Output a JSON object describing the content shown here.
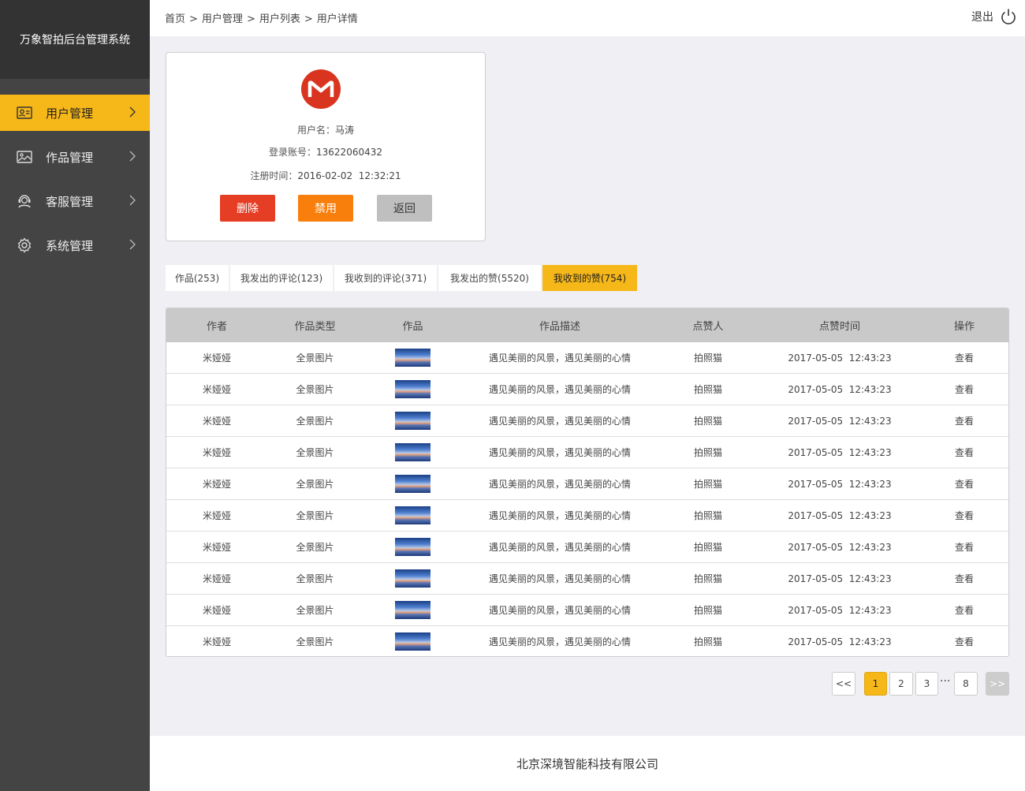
{
  "app": {
    "title": "万象智拍后台管理系统"
  },
  "sidebar": {
    "items": [
      {
        "label": "用户管理",
        "icon": "user-card-icon"
      },
      {
        "label": "作品管理",
        "icon": "image-icon"
      },
      {
        "label": "客服管理",
        "icon": "headset-icon"
      },
      {
        "label": "系统管理",
        "icon": "gear-icon"
      }
    ],
    "active_index": 0
  },
  "breadcrumb": {
    "items": [
      "首页",
      "用户管理",
      "用户列表",
      "用户详情"
    ],
    "separator": ">"
  },
  "header": {
    "logout_label": "退出",
    "logout_icon": "power-icon"
  },
  "user_card": {
    "username_label": "用户名：",
    "username": "马涛",
    "account_label": "登录账号：",
    "account": "13622060432",
    "register_label": "注册时间：",
    "register_time": "2016-02-02  12:32:21",
    "buttons": {
      "delete": "删除",
      "disable": "禁用",
      "back": "返回"
    }
  },
  "tabs": [
    {
      "label": "作品(253)"
    },
    {
      "label": "我发出的评论(123)"
    },
    {
      "label": "我收到的评论(371)"
    },
    {
      "label": "我发出的赞(5520)"
    },
    {
      "label": "我收到的赞(754)"
    }
  ],
  "active_tab": 4,
  "table": {
    "headers": [
      "作者",
      "作品类型",
      "作品",
      "作品描述",
      "点赞人",
      "点赞时间",
      "操作"
    ],
    "rows": [
      [
        "米娅娅",
        "全景图片",
        "",
        "遇见美丽的风景，遇见美丽的心情",
        "拍照猫",
        "2017-05-05  12:43:23",
        "查看"
      ],
      [
        "米娅娅",
        "全景图片",
        "",
        "遇见美丽的风景，遇见美丽的心情",
        "拍照猫",
        "2017-05-05  12:43:23",
        "查看"
      ],
      [
        "米娅娅",
        "全景图片",
        "",
        "遇见美丽的风景，遇见美丽的心情",
        "拍照猫",
        "2017-05-05  12:43:23",
        "查看"
      ],
      [
        "米娅娅",
        "全景图片",
        "",
        "遇见美丽的风景，遇见美丽的心情",
        "拍照猫",
        "2017-05-05  12:43:23",
        "查看"
      ],
      [
        "米娅娅",
        "全景图片",
        "",
        "遇见美丽的风景，遇见美丽的心情",
        "拍照猫",
        "2017-05-05  12:43:23",
        "查看"
      ],
      [
        "米娅娅",
        "全景图片",
        "",
        "遇见美丽的风景，遇见美丽的心情",
        "拍照猫",
        "2017-05-05  12:43:23",
        "查看"
      ],
      [
        "米娅娅",
        "全景图片",
        "",
        "遇见美丽的风景，遇见美丽的心情",
        "拍照猫",
        "2017-05-05  12:43:23",
        "查看"
      ],
      [
        "米娅娅",
        "全景图片",
        "",
        "遇见美丽的风景，遇见美丽的心情",
        "拍照猫",
        "2017-05-05  12:43:23",
        "查看"
      ],
      [
        "米娅娅",
        "全景图片",
        "",
        "遇见美丽的风景，遇见美丽的心情",
        "拍照猫",
        "2017-05-05  12:43:23",
        "查看"
      ],
      [
        "米娅娅",
        "全景图片",
        "",
        "遇见美丽的风景，遇见美丽的心情",
        "拍照猫",
        "2017-05-05  12:43:23",
        "查看"
      ]
    ]
  },
  "pagination": {
    "prev": "<<",
    "pages": [
      "1",
      "2",
      "3"
    ],
    "ellipsis": "···",
    "last": "8",
    "next": ">>",
    "current": "1"
  },
  "footer": {
    "company": "北京深境智能科技有限公司"
  },
  "colors": {
    "accent": "#f6b718",
    "delete": "#e63d25",
    "disable": "#f97f0c",
    "back": "#bfbfbf",
    "sidebar": "#444444"
  }
}
